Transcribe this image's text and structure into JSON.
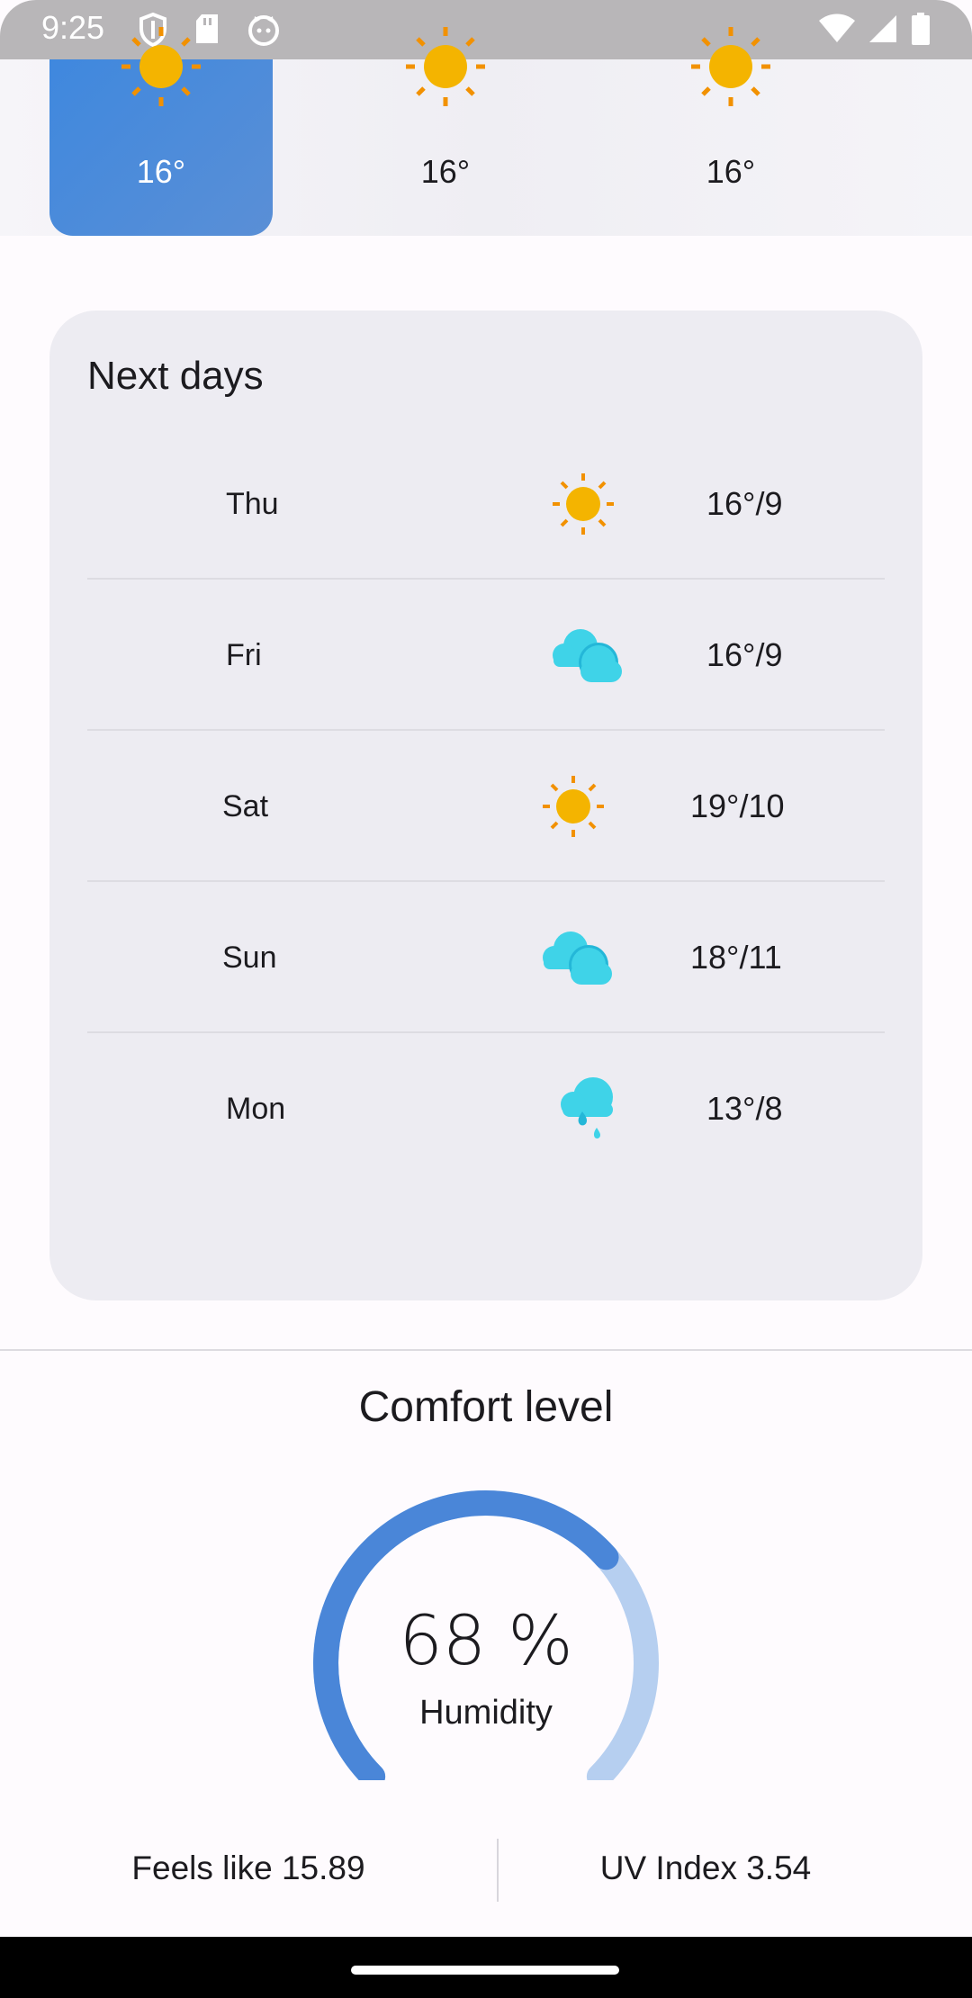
{
  "status_bar": {
    "time": "9:25",
    "left_icons": [
      "shield-icon",
      "sd-card-icon",
      "cat-icon"
    ],
    "right_icons": [
      "wifi-icon",
      "signal-icon",
      "battery-icon"
    ]
  },
  "hourly": [
    {
      "temp": "16°",
      "icon": "sun-icon",
      "selected": true
    },
    {
      "temp": "16°",
      "icon": "sun-icon",
      "selected": false
    },
    {
      "temp": "16°",
      "icon": "sun-icon",
      "selected": false
    }
  ],
  "next_days": {
    "title": "Next days",
    "days": [
      {
        "day": "Thu",
        "icon": "sun-icon",
        "temp": "16°/9"
      },
      {
        "day": "Fri",
        "icon": "cloud-icon",
        "temp": "16°/9"
      },
      {
        "day": "Sat",
        "icon": "sun-icon",
        "temp": "19°/10"
      },
      {
        "day": "Sun",
        "icon": "cloud-icon",
        "temp": "18°/11"
      },
      {
        "day": "Mon",
        "icon": "rain-icon",
        "temp": "13°/8"
      }
    ]
  },
  "comfort": {
    "title": "Comfort level",
    "humidity_value": "68 %",
    "humidity_fraction": 0.68,
    "humidity_label": "Humidity",
    "feels_like": "Feels like 15.89",
    "uv_index": "UV Index 3.54"
  },
  "colors": {
    "accent": "#4a86d8",
    "gauge_track": "#b6cff0",
    "sun": "#f4b400",
    "sun_rays": "#f29100",
    "cloud": "#3fd3e8",
    "cloud_dark": "#24b7d8"
  }
}
